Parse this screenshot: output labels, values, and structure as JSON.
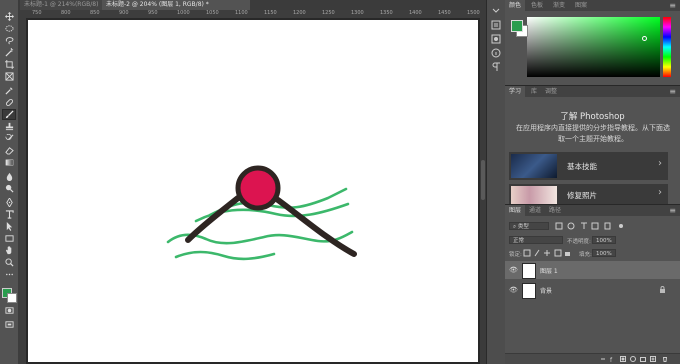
{
  "document_tabs": [
    {
      "label": "未标题-1 @ 214%(RGB/8)",
      "active": false
    },
    {
      "label": "未标题-2 @ 204% (图层 1, RGB/8) *",
      "active": true
    }
  ],
  "ruler_labels": [
    "750",
    "800",
    "850",
    "900",
    "950",
    "1000",
    "1050",
    "1100",
    "1150",
    "1200",
    "1250",
    "1300",
    "1350",
    "1400",
    "1450",
    "1500"
  ],
  "color_panel": {
    "tabs": [
      "颜色",
      "色板",
      "渐变",
      "图案"
    ],
    "foreground_color": "#2a9d4e",
    "background_color": "#ffffff",
    "hue_base": "#00ff22"
  },
  "learn_panel": {
    "tabs": [
      "学习",
      "库",
      "调整"
    ],
    "title": "了解 Photoshop",
    "description": "在应用程序内直接提供的分步指导教程。从下面选取一个主题开始教程。",
    "cards": [
      {
        "label": "基本技能"
      },
      {
        "label": "修复照片"
      }
    ]
  },
  "layers_panel": {
    "tabs": [
      "图层",
      "通道",
      "路径"
    ],
    "filter_label": "类型",
    "blend_mode": "正常",
    "opacity_label": "不透明度:",
    "opacity_value": "100%",
    "lock_label": "锁定:",
    "fill_label": "填充:",
    "fill_value": "100%",
    "layers": [
      {
        "name": "图层 1",
        "selected": true
      },
      {
        "name": "背景",
        "selected": false,
        "locked": true
      }
    ]
  },
  "tools": [
    "move-tool",
    "marquee-tool",
    "lasso-tool",
    "magic-wand-tool",
    "crop-tool",
    "frame-tool",
    "eyedropper-tool",
    "healing-brush-tool",
    "brush-tool",
    "clone-stamp-tool",
    "history-brush-tool",
    "eraser-tool",
    "gradient-tool",
    "blur-tool",
    "dodge-tool",
    "pen-tool",
    "type-tool",
    "path-selection-tool",
    "rectangle-tool",
    "hand-tool",
    "zoom-tool",
    "more-tools"
  ],
  "artwork": {
    "circle_fill": "#dc1450",
    "stroke_color": "#2e2522",
    "wave_color": "#3cb86b"
  }
}
